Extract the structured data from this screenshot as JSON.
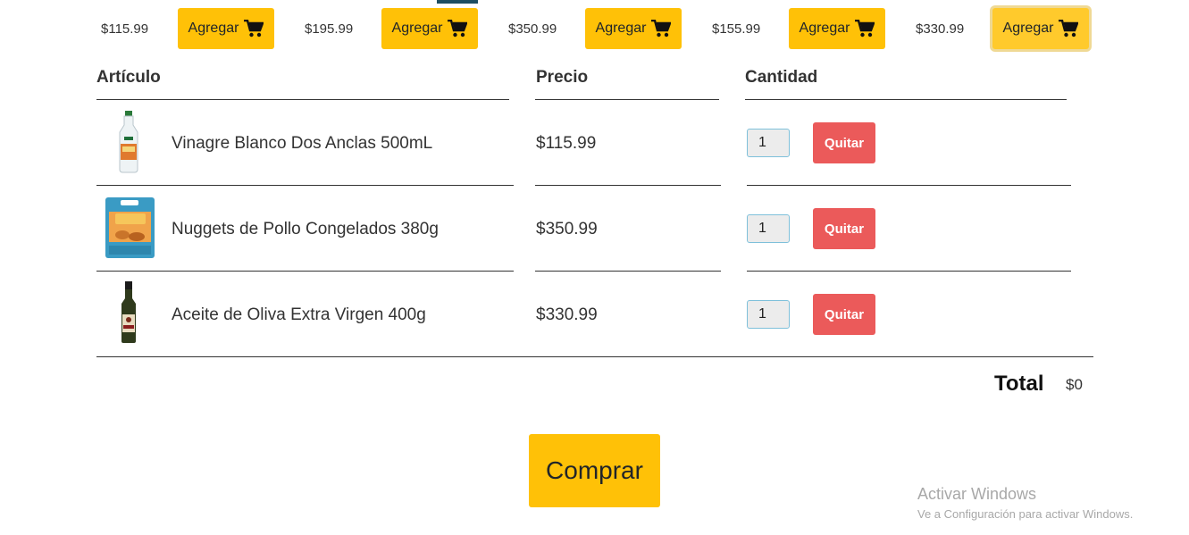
{
  "top_products": [
    {
      "price": "$115.99",
      "add_label": "Agregar"
    },
    {
      "price": "$195.99",
      "add_label": "Agregar"
    },
    {
      "price": "$350.99",
      "add_label": "Agregar"
    },
    {
      "price": "$155.99",
      "add_label": "Agregar"
    },
    {
      "price": "$330.99",
      "add_label": "Agregar"
    }
  ],
  "cart": {
    "headers": {
      "item": "Artículo",
      "price": "Precio",
      "quantity": "Cantidad"
    },
    "rows": [
      {
        "name": "Vinagre Blanco Dos Anclas 500mL",
        "price": "$115.99",
        "quantity": "1",
        "remove_label": "Quitar",
        "thumb_icon": "vinegar-bottle-icon"
      },
      {
        "name": "Nuggets de Pollo Congelados 380g",
        "price": "$350.99",
        "quantity": "1",
        "remove_label": "Quitar",
        "thumb_icon": "chicken-nuggets-bag-icon"
      },
      {
        "name": "Aceite de Oliva Extra Virgen 400g",
        "price": "$330.99",
        "quantity": "1",
        "remove_label": "Quitar",
        "thumb_icon": "olive-oil-bottle-icon"
      }
    ],
    "total_label": "Total",
    "total_value": "$0"
  },
  "buy_label": "Comprar",
  "windows_watermark": {
    "title": "Activar Windows",
    "subtitle": "Ve a Configuración para activar Windows."
  },
  "colors": {
    "accent": "#ffc107",
    "danger": "#eb5a5a"
  }
}
